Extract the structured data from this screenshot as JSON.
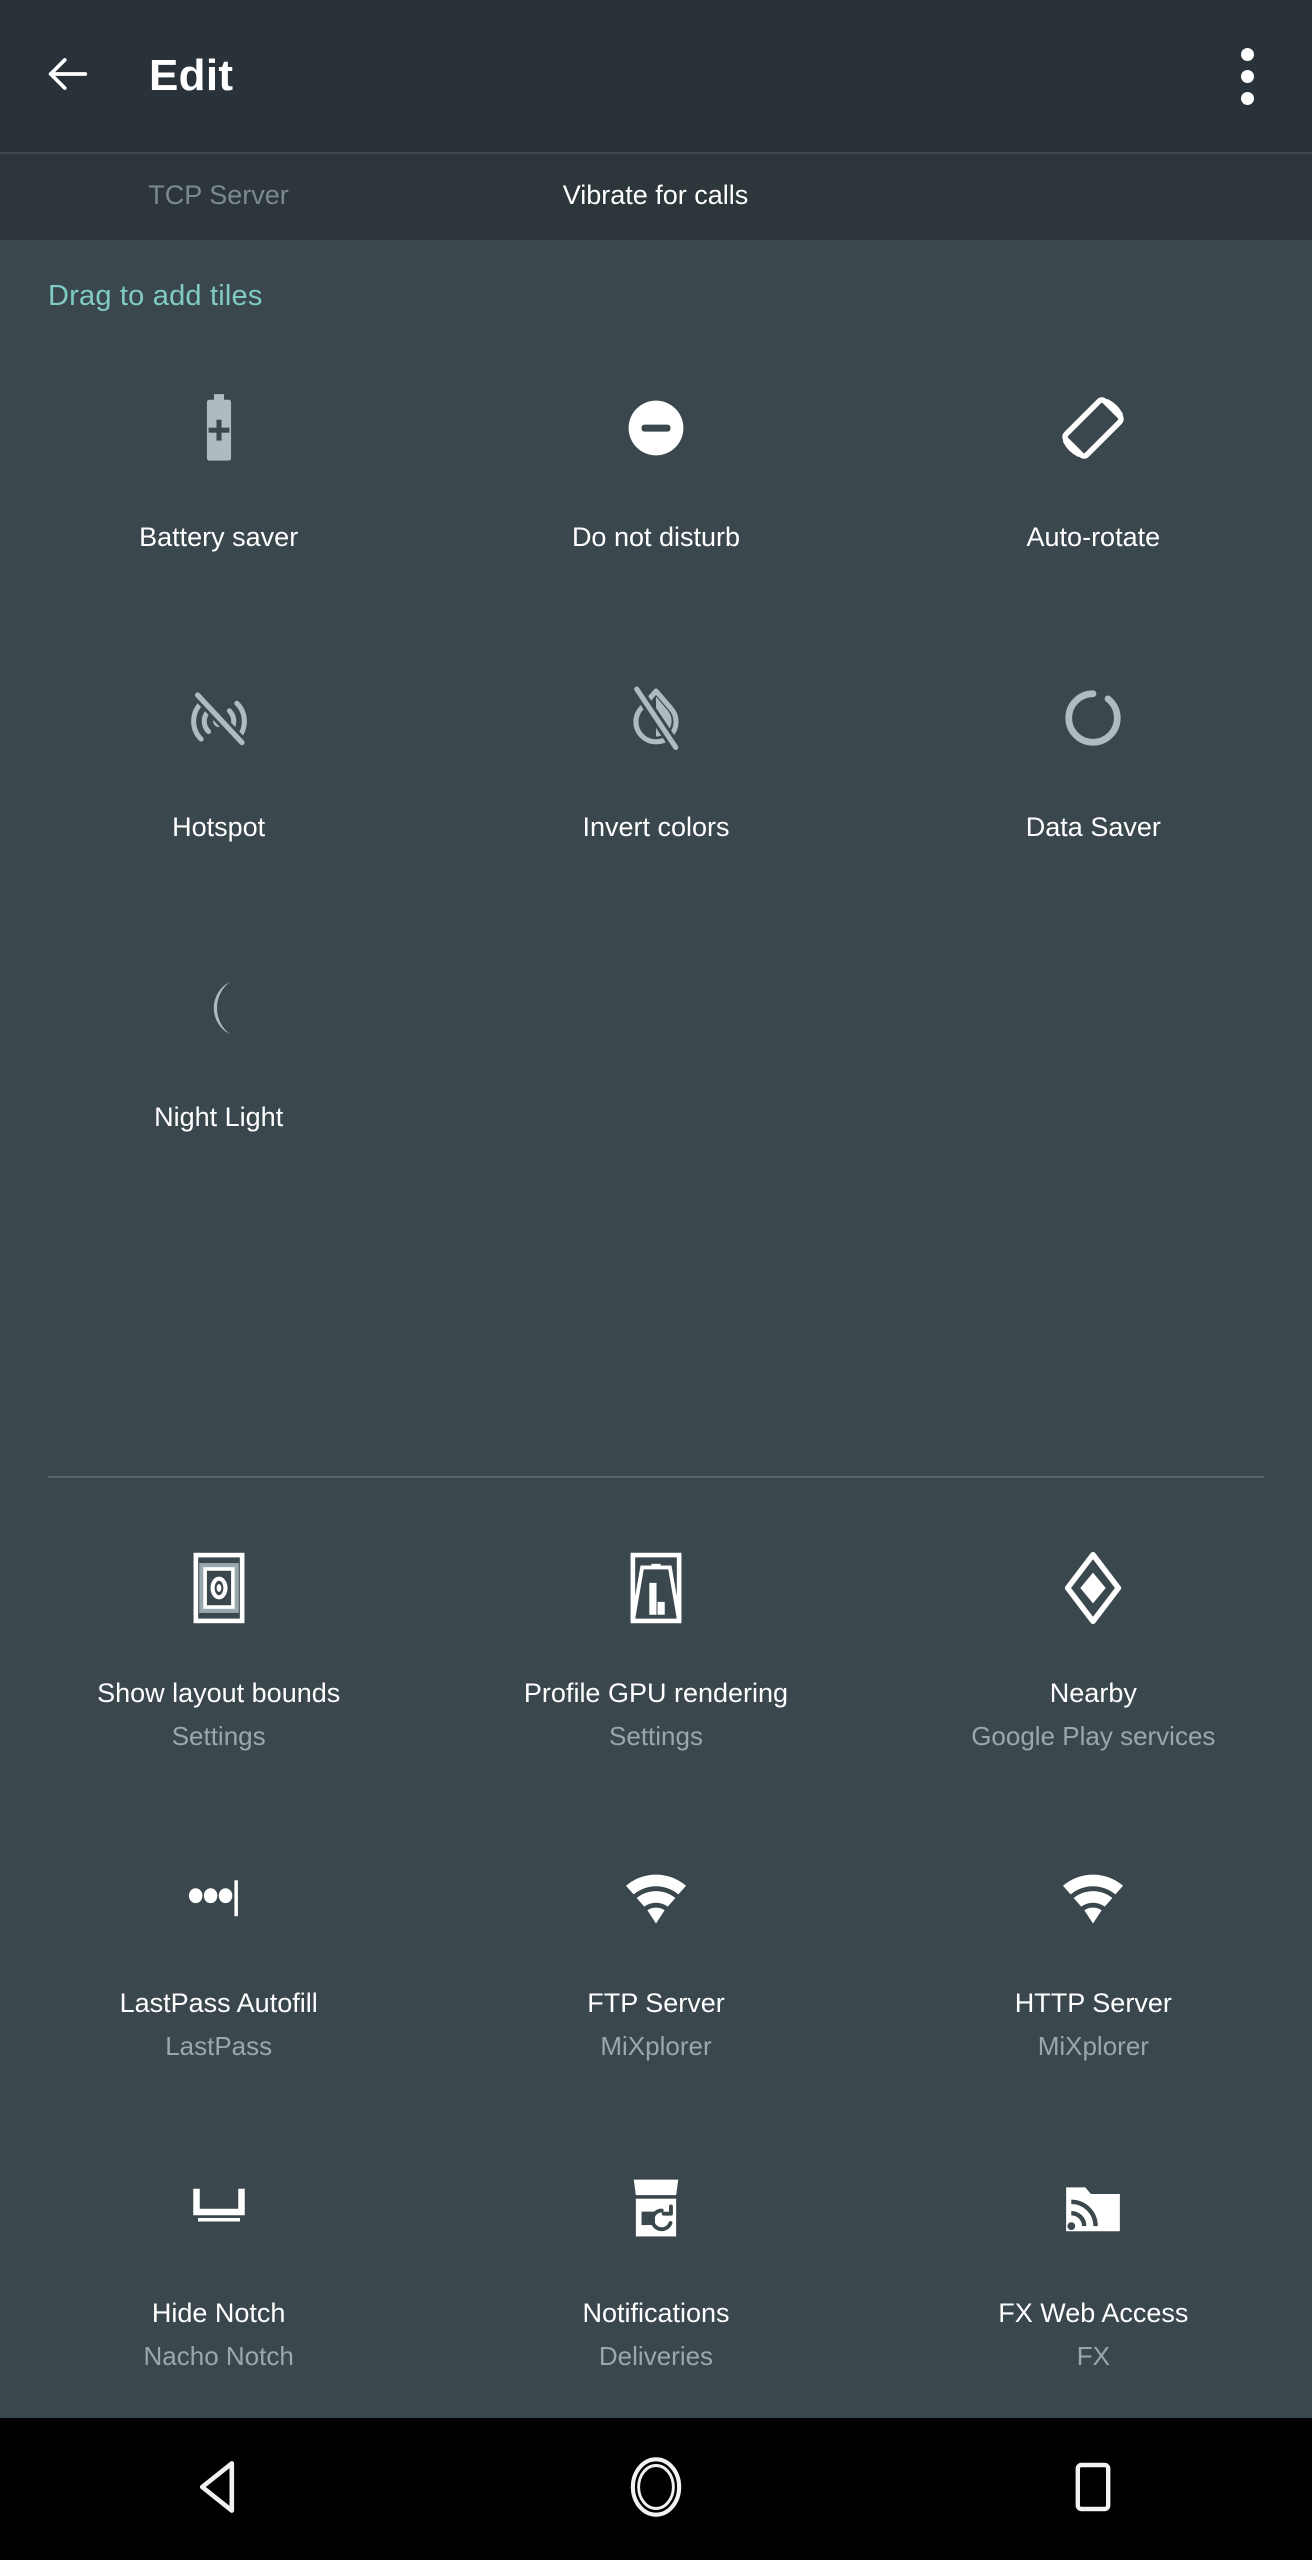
{
  "toolbar": {
    "title": "Edit",
    "back_icon": "arrow-left-icon",
    "overflow_icon": "more-vertical-icon"
  },
  "current_tiles_strip": {
    "tiles": [
      {
        "label": "TCP Server",
        "state": "inactive"
      },
      {
        "label": "Vibrate for calls",
        "state": "active"
      },
      {
        "label": "",
        "state": "empty"
      }
    ]
  },
  "section_header": "Drag to add tiles",
  "colors": {
    "accent": "#80cbc4",
    "toolbar_bg": "#293238",
    "strip_bg": "#2c363b",
    "body_bg": "#3a474d",
    "navbar_bg": "#000000",
    "label": "#ffffff",
    "sublabel": "#9aa7ac",
    "icon_active": "#ffffff",
    "icon_inactive": "#b0bbbf",
    "divider": "#586469"
  },
  "system_tiles": [
    {
      "label": "Battery saver",
      "sublabel": "",
      "icon": "battery-saver-icon",
      "icon_state": "inactive"
    },
    {
      "label": "Do not disturb",
      "sublabel": "",
      "icon": "do-not-disturb-icon",
      "icon_state": "active"
    },
    {
      "label": "Auto-rotate",
      "sublabel": "",
      "icon": "auto-rotate-icon",
      "icon_state": "active"
    },
    {
      "label": "Hotspot",
      "sublabel": "",
      "icon": "hotspot-off-icon",
      "icon_state": "inactive"
    },
    {
      "label": "Invert colors",
      "sublabel": "",
      "icon": "invert-colors-off-icon",
      "icon_state": "inactive"
    },
    {
      "label": "Data Saver",
      "sublabel": "",
      "icon": "data-saver-icon",
      "icon_state": "inactive"
    },
    {
      "label": "Night Light",
      "sublabel": "",
      "icon": "night-light-moon-icon",
      "icon_state": "inactive"
    }
  ],
  "app_tiles": [
    {
      "label": "Show layout bounds",
      "sublabel": "Settings",
      "icon": "show-layout-bounds-icon",
      "icon_state": "active"
    },
    {
      "label": "Profile GPU rendering",
      "sublabel": "Settings",
      "icon": "profile-gpu-rendering-icon",
      "icon_state": "active"
    },
    {
      "label": "Nearby",
      "sublabel": "Google Play services",
      "icon": "nearby-diamond-icon",
      "icon_state": "active"
    },
    {
      "label": "LastPass Autofill",
      "sublabel": "LastPass",
      "icon": "lastpass-autofill-icon",
      "icon_state": "active"
    },
    {
      "label": "FTP Server",
      "sublabel": "MiXplorer",
      "icon": "wifi-icon",
      "icon_state": "active"
    },
    {
      "label": "HTTP Server",
      "sublabel": "MiXplorer",
      "icon": "wifi-icon",
      "icon_state": "active"
    },
    {
      "label": "Hide Notch",
      "sublabel": "Nacho Notch",
      "icon": "hide-notch-icon",
      "icon_state": "active"
    },
    {
      "label": "Notifications",
      "sublabel": "Deliveries",
      "icon": "package-refresh-icon",
      "icon_state": "active"
    },
    {
      "label": "FX Web Access",
      "sublabel": "FX",
      "icon": "folder-wifi-icon",
      "icon_state": "active"
    }
  ],
  "navbar": {
    "buttons": [
      {
        "name": "back",
        "icon": "triangle-back-icon"
      },
      {
        "name": "home",
        "icon": "circle-home-icon"
      },
      {
        "name": "recents",
        "icon": "square-recents-icon"
      }
    ]
  }
}
